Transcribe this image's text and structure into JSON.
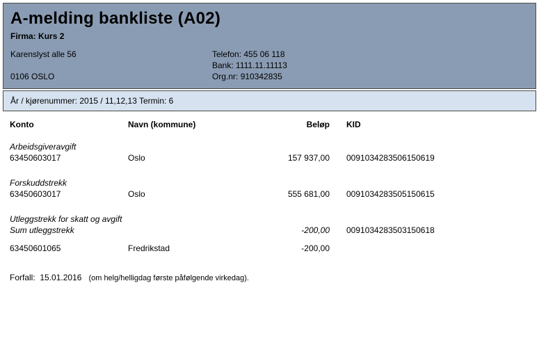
{
  "header": {
    "title": "A-melding bankliste (A02)",
    "firma_label": "Firma:",
    "firma_name": "Kurs 2",
    "address_line1": "Karenslyst alle 56",
    "address_line2": "0106 OSLO",
    "telefon_label": "Telefon:",
    "telefon": "455 06 118",
    "bank_label": "Bank:",
    "bank": "1111.11.11113",
    "orgnr_label": "Org.nr:",
    "orgnr": "910342835"
  },
  "params": {
    "line": "År / kjørenummer: 2015 / 11,12,13  Termin: 6"
  },
  "columns": {
    "konto": "Konto",
    "navn": "Navn (kommune)",
    "belop": "Beløp",
    "kid": "KID"
  },
  "sections": [
    {
      "label": "Arbeidsgiveravgift",
      "rows": [
        {
          "konto": "63450603017",
          "navn": "Oslo",
          "belop": "157 937,00",
          "kid": "0091034283506150619"
        }
      ]
    },
    {
      "label": "Forskuddstrekk",
      "rows": [
        {
          "konto": "63450603017",
          "navn": "Oslo",
          "belop": "555 681,00",
          "kid": "0091034283505150615"
        }
      ]
    }
  ],
  "utlegg": {
    "label": "Utleggstrekk for skatt og avgift",
    "sum_label": "Sum utleggstrekk",
    "sum_belop": "-200,00",
    "sum_kid": "0091034283503150618",
    "rows": [
      {
        "konto": "63450601065",
        "navn": "Fredrikstad",
        "belop": "-200,00",
        "kid": ""
      }
    ]
  },
  "footer": {
    "forfall_label": "Forfall:",
    "forfall_date": "15.01.2016",
    "forfall_hint": "(om helg/helligdag første påfølgende virkedag)."
  }
}
